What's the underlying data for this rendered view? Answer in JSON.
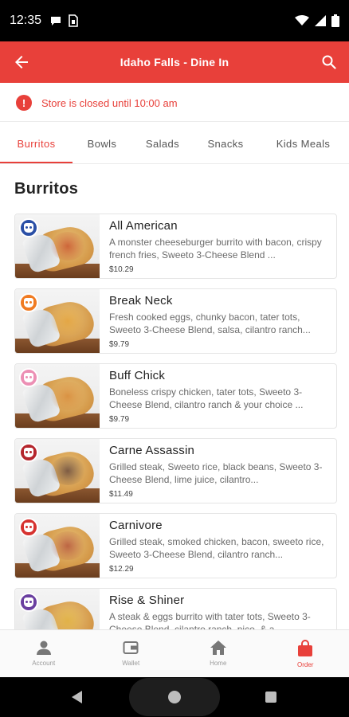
{
  "status_bar": {
    "time": "12:35",
    "icons": [
      "chat-bubble-icon",
      "sim-card-icon",
      "wifi-icon",
      "cellular-signal-icon",
      "battery-icon"
    ]
  },
  "header": {
    "title": "Idaho Falls - Dine In",
    "back_icon": "arrow-left-icon",
    "search_icon": "search-icon",
    "background_color": "#e8403a"
  },
  "notice": {
    "text": "Store is closed until 10:00 am",
    "icon": "!",
    "color": "#e8403a"
  },
  "tabs": [
    {
      "label": "Burritos",
      "active": true
    },
    {
      "label": "Bowls",
      "active": false
    },
    {
      "label": "Salads",
      "active": false
    },
    {
      "label": "Snacks",
      "active": false
    },
    {
      "label": "Kids Meals",
      "active": false
    }
  ],
  "section_title": "Burritos",
  "items": [
    {
      "name": "All American",
      "description": "A monster cheeseburger burrito with bacon, crispy french fries, Sweeto 3-Cheese Blend ...",
      "price": "$10.29",
      "badge_color": "#2a4fa6",
      "fill_color": "#c9562f"
    },
    {
      "name": "Break Neck",
      "description": "Fresh cooked eggs, chunky bacon, tater tots, Sweeto 3-Cheese Blend, salsa, cilantro ranch...",
      "price": "$9.79",
      "badge_color": "#f07b22",
      "fill_color": "#e3a23c"
    },
    {
      "name": "Buff Chick",
      "description": "Boneless crispy chicken, tater tots, Sweeto 3-Cheese Blend, cilantro ranch & your choice ...",
      "price": "$9.79",
      "badge_color": "#ec8fb4",
      "fill_color": "#d78a3a"
    },
    {
      "name": "Carne Assassin",
      "description": "Grilled steak, Sweeto rice, black beans, Sweeto 3-Cheese Blend, lime juice, cilantro...",
      "price": "$11.49",
      "badge_color": "#b5262d",
      "fill_color": "#6b4a3a"
    },
    {
      "name": "Carnivore",
      "description": "Grilled steak, smoked chicken, bacon, sweeto rice, Sweeto 3-Cheese Blend, cilantro ranch...",
      "price": "$12.29",
      "badge_color": "#d6322f",
      "fill_color": "#b5553a"
    },
    {
      "name": "Rise & Shiner",
      "description": "A steak & eggs burrito with tater tots, Sweeto 3-Cheese Blend, cilantro ranch, pico, & a ...",
      "price": "",
      "badge_color": "#6a3fa0",
      "fill_color": "#e0b040"
    }
  ],
  "bottom_nav": [
    {
      "label": "Account",
      "icon": "person-icon",
      "active": false
    },
    {
      "label": "Wallet",
      "icon": "wallet-icon",
      "active": false
    },
    {
      "label": "Home",
      "icon": "home-icon",
      "active": false
    },
    {
      "label": "Order",
      "icon": "shopping-bag-icon",
      "active": true
    }
  ]
}
